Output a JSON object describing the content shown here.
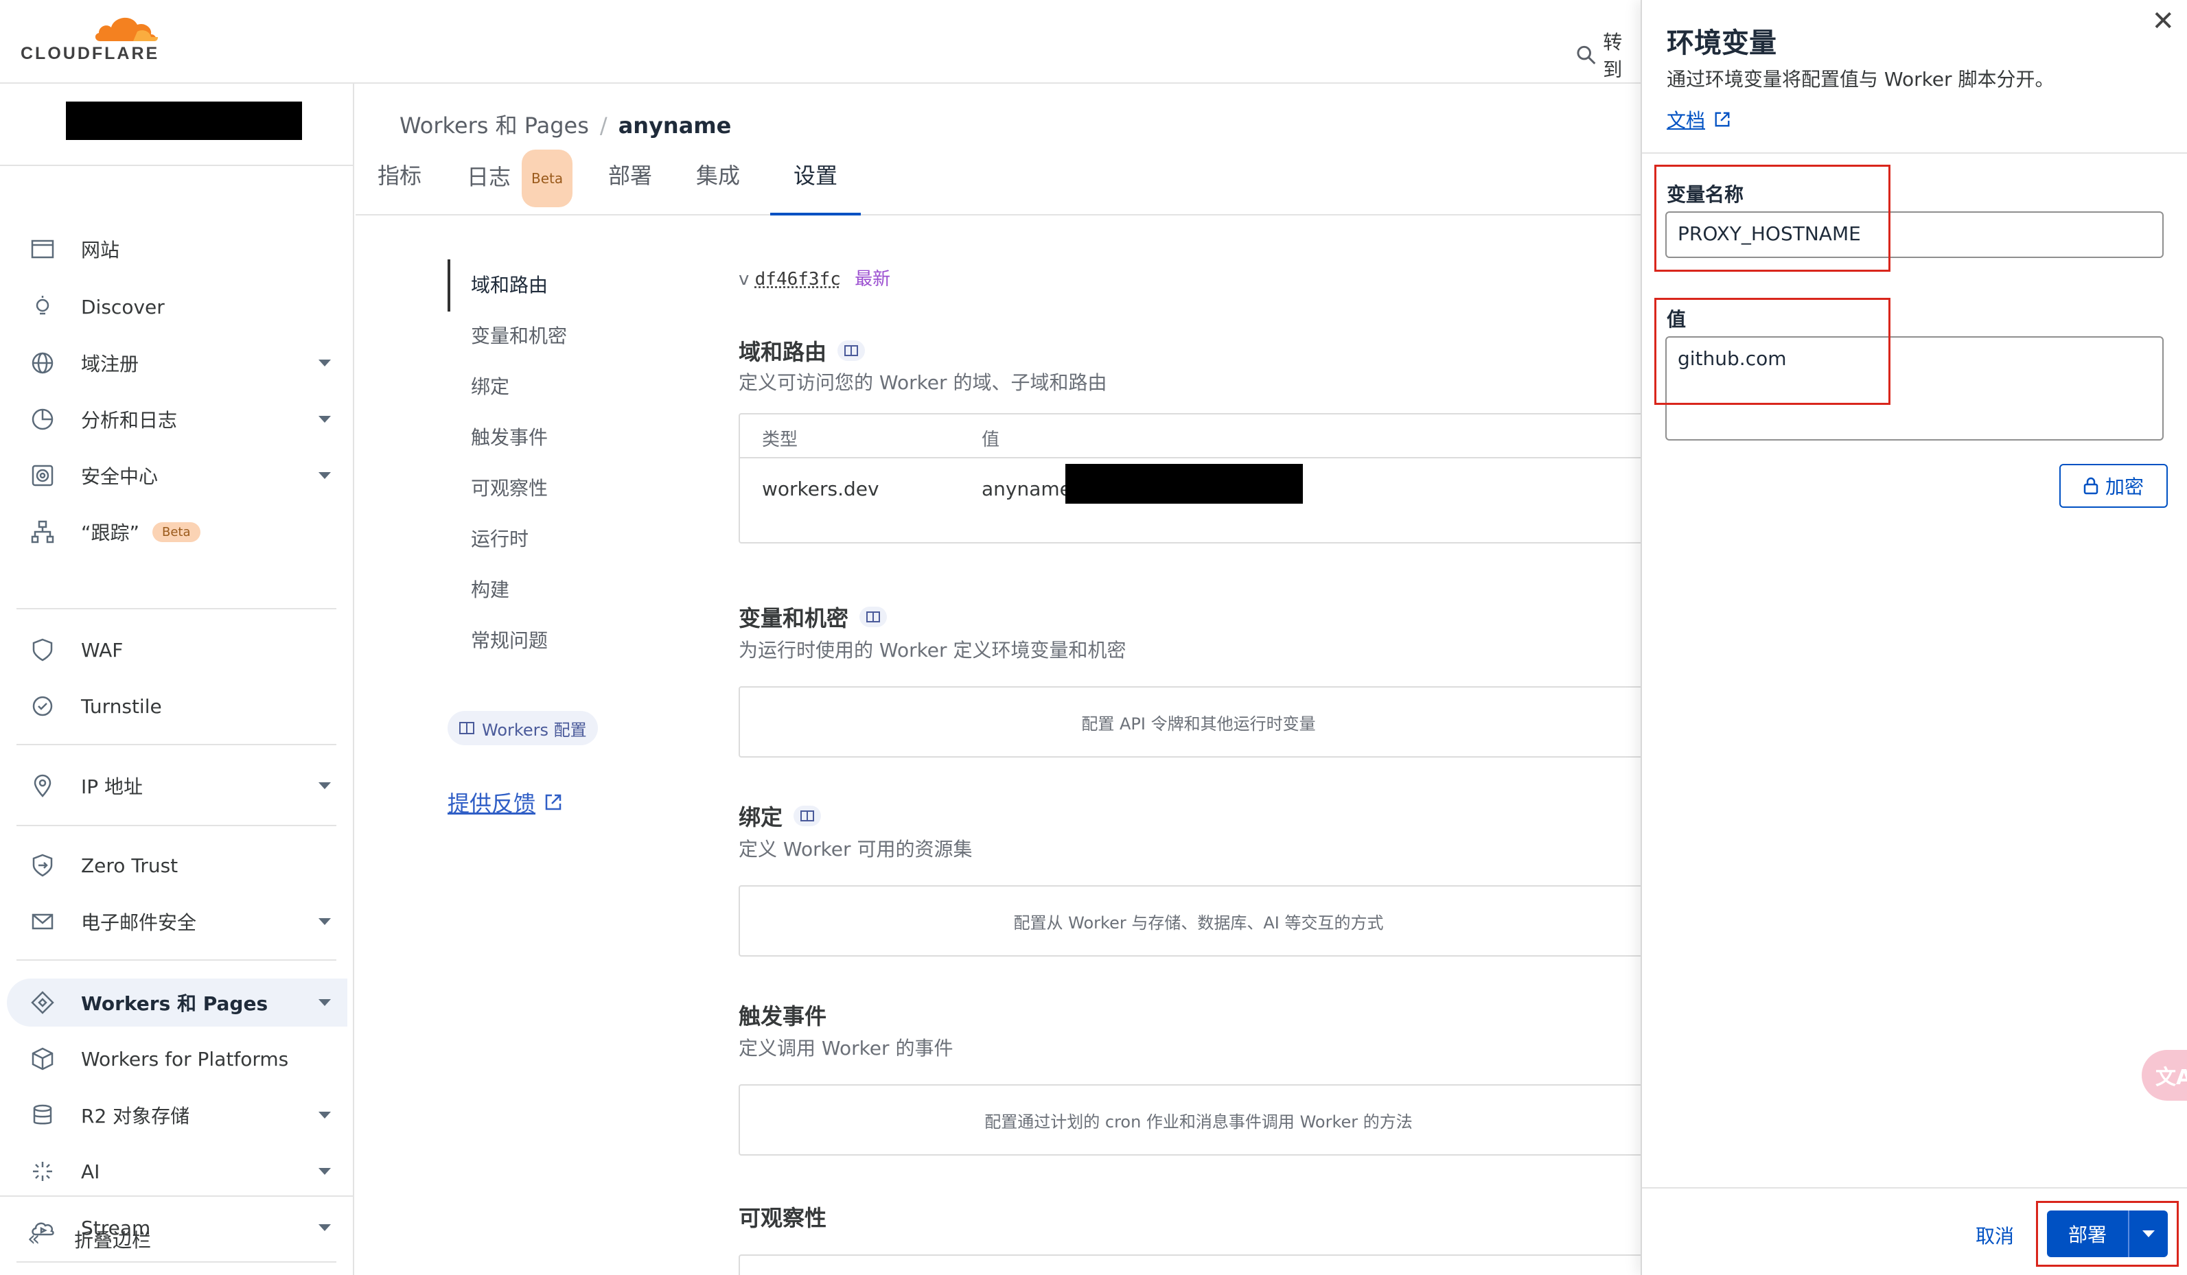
{
  "brand": {
    "logo_text": "CLOUDFLARE",
    "accent": "#f48120"
  },
  "header": {
    "goto_label": "转到"
  },
  "sidebar": {
    "items": [
      {
        "label": "网站",
        "icon": "browser-icon",
        "has_caret": false
      },
      {
        "label": "Discover",
        "icon": "lightbulb-icon",
        "has_caret": false
      },
      {
        "label": "域注册",
        "icon": "globe-icon",
        "has_caret": true
      },
      {
        "label": "分析和日志",
        "icon": "pie-chart-icon",
        "has_caret": true
      },
      {
        "label": "安全中心",
        "icon": "radar-icon",
        "has_caret": true
      },
      {
        "label": "“跟踪”",
        "icon": "sitemap-icon",
        "has_caret": false,
        "badge": "Beta"
      },
      {
        "label": "WAF",
        "icon": "shield-icon",
        "has_caret": false
      },
      {
        "label": "Turnstile",
        "icon": "turnstile-icon",
        "has_caret": false
      },
      {
        "label": "IP 地址",
        "icon": "location-pin-icon",
        "has_caret": true
      },
      {
        "label": "Zero Trust",
        "icon": "zero-trust-icon",
        "has_caret": false
      },
      {
        "label": "电子邮件安全",
        "icon": "envelope-icon",
        "has_caret": true
      },
      {
        "label": "Workers 和 Pages",
        "icon": "workers-icon",
        "has_caret": true,
        "active": true
      },
      {
        "label": "Workers for Platforms",
        "icon": "cube-icon",
        "has_caret": false
      },
      {
        "label": "R2 对象存储",
        "icon": "database-icon",
        "has_caret": true
      },
      {
        "label": "AI",
        "icon": "sparkle-icon",
        "has_caret": true
      },
      {
        "label": "Stream",
        "icon": "stream-cloud-icon",
        "has_caret": true
      }
    ],
    "collapse_label": "折叠边栏"
  },
  "breadcrumb": {
    "parent": "Workers 和 Pages",
    "separator": "/",
    "current": "anyname"
  },
  "tabs": [
    {
      "label": "指标"
    },
    {
      "label": "日志",
      "badge": "Beta"
    },
    {
      "label": "部署"
    },
    {
      "label": "集成"
    },
    {
      "label": "设置",
      "active": true
    }
  ],
  "settings_nav": {
    "items": [
      "域和路由",
      "变量和机密",
      "绑定",
      "触发事件",
      "可观察性",
      "运行时",
      "构建",
      "常规问题"
    ],
    "workers_config": "Workers 配置",
    "feedback": "提供反馈"
  },
  "version": {
    "prefix": "v",
    "hash": "df46f3fc",
    "tag": "最新"
  },
  "sections": {
    "domains": {
      "title": "域和路由",
      "desc": "定义可访问您的 Worker 的域、子域和路由",
      "table": {
        "headers": [
          "类型",
          "值"
        ],
        "rows": [
          {
            "type": "workers.dev",
            "value": "anyname."
          }
        ]
      }
    },
    "variables": {
      "title": "变量和机密",
      "desc": "为运行时使用的 Worker 定义环境变量和机密",
      "placeholder": "配置 API 令牌和其他运行时变量"
    },
    "bindings": {
      "title": "绑定",
      "desc": "定义 Worker 可用的资源集",
      "placeholder": "配置从 Worker 与存储、数据库、AI 等交互的方式"
    },
    "triggers": {
      "title": "触发事件",
      "desc": "定义调用 Worker 的事件",
      "placeholder": "配置通过计划的 cron 作业和消息事件调用 Worker 的方法"
    },
    "observability": {
      "title": "可观察性"
    }
  },
  "drawer": {
    "title": "环境变量",
    "desc": "通过环境变量将配置值与 Worker 脚本分开。",
    "docs_label": "文档",
    "name_label": "变量名称",
    "name_value": "PROXY_HOSTNAME",
    "value_label": "值",
    "value_value": "github.com",
    "encrypt_label": "加密",
    "cancel_label": "取消",
    "deploy_label": "部署"
  },
  "colors": {
    "primary": "#0051c3",
    "highlight": "#d9261c",
    "badge_bg": "#fbd3b4"
  }
}
